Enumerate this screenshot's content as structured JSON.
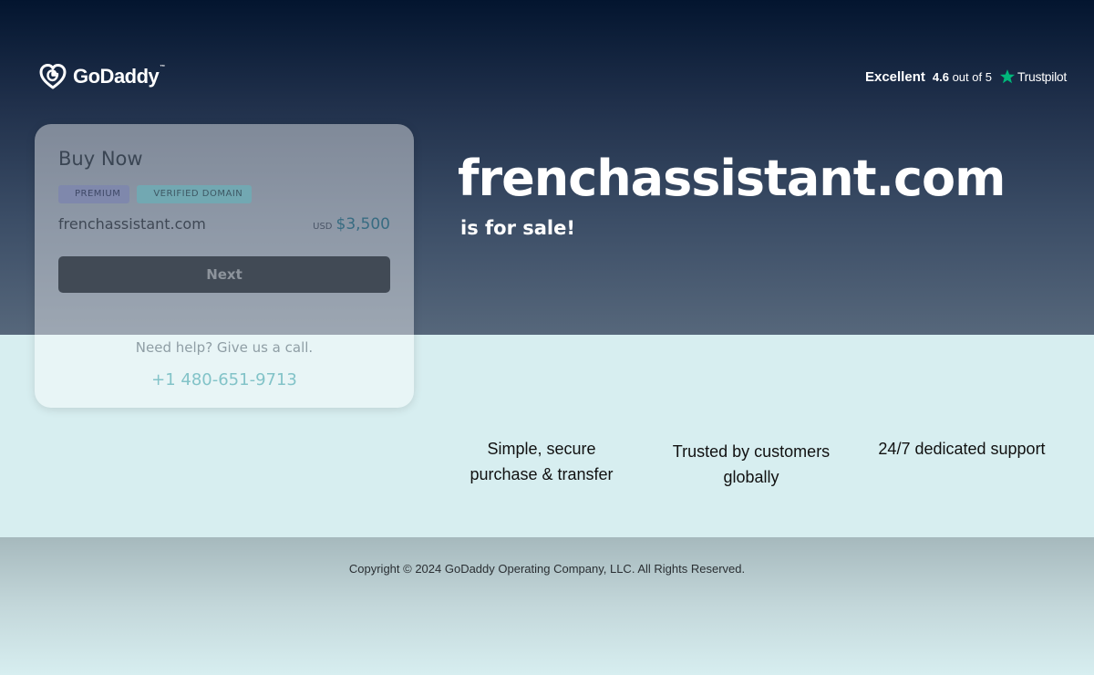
{
  "brand": {
    "logo_text": "GoDaddy",
    "logo_tm": "™",
    "logo_icon": "godaddy-heart-icon"
  },
  "trustpilot": {
    "excellent": "Excellent",
    "rating_prefix": "4.6",
    "rating_suffix": "out of 5",
    "brand": "Trustpilot",
    "star_color": "#00b67a",
    "icon": "star-icon"
  },
  "card": {
    "title": "Buy Now",
    "badges": [
      "PREMIUM",
      "VERIFIED DOMAIN"
    ],
    "domain": "frenchassistant.com",
    "currency": "USD",
    "price": "$3,500",
    "next_label": "Next",
    "help_text": "Need help? Give us a call.",
    "phone": "+1 480-651-9713"
  },
  "hero": {
    "domain": "frenchassistant.com",
    "subtitle": "is for sale!"
  },
  "features": [
    {
      "line1": "Simple, secure",
      "line2": "purchase & transfer"
    },
    {
      "line1": "Trusted by customers",
      "line2": "globally"
    },
    {
      "line1": "24/7 dedicated support",
      "line2": ""
    }
  ],
  "footer": {
    "copyright": "Copyright © 2024 GoDaddy Operating Company, LLC. All Rights Reserved."
  },
  "colors": {
    "accent": "#386c82",
    "button": "#414a55",
    "phone": "#82c3c8",
    "band": "#d7eef0"
  }
}
